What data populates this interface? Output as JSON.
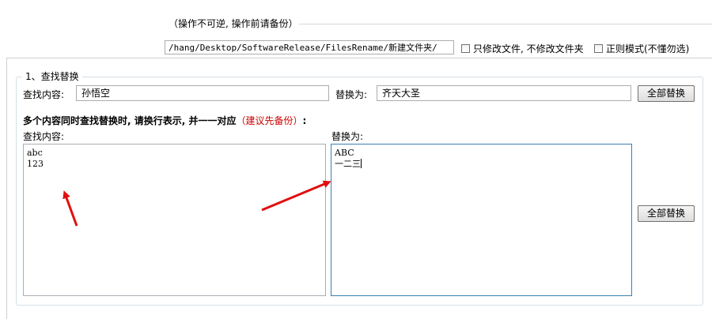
{
  "header": {
    "warning": "（操作不可逆, 操作前请备份）",
    "path": "/hang/Desktop/SoftwareRelease/FilesRename/新建文件夹/",
    "only_files_label": "只修改文件, 不修改文件夹",
    "regex_label": "正则模式(不懂勿选)"
  },
  "group": {
    "title": "1、查找替换",
    "find_label": "查找内容:",
    "find_value": "孙悟空",
    "replace_label": "替换为:",
    "replace_value": "齐天大圣",
    "replace_all_label": "全部替换",
    "multi_title": "多个内容同时查找替换时, 请换行表示, 并一一对应",
    "multi_title_red": "（建议先备份）",
    "multi_title_colon": ":",
    "multi_find_label": "查找内容:",
    "multi_find_lines": [
      "abc",
      "123"
    ],
    "multi_replace_label": "替换为:",
    "multi_replace_lines": [
      "ABC",
      "一二三"
    ],
    "multi_replace_all_label": "全部替换"
  },
  "colors": {
    "arrow": "#e01010",
    "hint_red": "#cc0000",
    "focus_border": "#3c7fb1"
  }
}
